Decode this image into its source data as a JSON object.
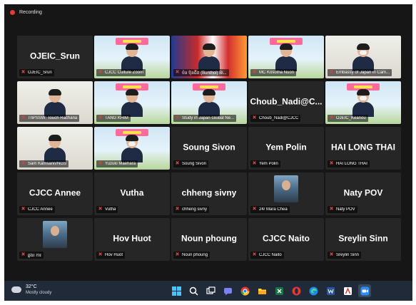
{
  "recording": {
    "label": "Recording"
  },
  "tiles": [
    {
      "name": "OJEIC_Srun",
      "label": "OJEIC_Srun"
    },
    {
      "label": "CJCC Culture Zoom"
    },
    {
      "label": "ប៉ន ប៊ុនធីត (Bunthol) Bl..."
    },
    {
      "label": "MC Kosotha Nuon"
    },
    {
      "label": "Embassy of Japan in Cam..."
    },
    {
      "label": "TriPSSW: Touch Rachana"
    },
    {
      "label": "TANG KHIM"
    },
    {
      "label": "Study in Japan Global Ne..."
    },
    {
      "name": "Choub_Nadi@C...",
      "label": "Choub_Nadi@CJCC"
    },
    {
      "label": "OJEIC_Keanou"
    },
    {
      "label": "Sam Kamsann/NGS"
    },
    {
      "label": "Yuzuki Maehara"
    },
    {
      "name": "Soung Sivon",
      "label": "Soung Sivon"
    },
    {
      "name": "Yem Polin",
      "label": "Yem Polin"
    },
    {
      "name": "HAI LONG THAI",
      "label": "HAI LONG THAI"
    },
    {
      "name": "CJCC Annee",
      "label": "CJCC Annee"
    },
    {
      "name": "Vutha",
      "label": "Vutha"
    },
    {
      "name": "chheng sivny",
      "label": "chheng sivny"
    },
    {
      "label": "24/ Mara Chea"
    },
    {
      "name": "Naty POV",
      "label": "Naty POV"
    },
    {
      "label": "ឆ្លងរ ការ"
    },
    {
      "name": "Hov Huot",
      "label": "Hov Huot"
    },
    {
      "name": "Noun phoung",
      "label": "Noun phoung"
    },
    {
      "name": "CJCC Naito",
      "label": "CJCC Naito"
    },
    {
      "name": "Sreylin Sinn",
      "label": "Sreylin Sinn"
    }
  ],
  "taskbar": {
    "weather": {
      "temperature": "32°C",
      "condition": "Mostly cloudy"
    },
    "icons": [
      "windows-start-icon",
      "search-icon",
      "task-view-icon",
      "teams-chat-icon",
      "chrome-icon",
      "file-explorer-icon",
      "excel-icon",
      "opera-icon",
      "edge-icon",
      "word-icon",
      "acrobat-icon",
      "zoom-icon"
    ]
  },
  "colors": {
    "screen": "#161616",
    "tile": "#262626",
    "muted": "#e53935",
    "active_speaker": "#f5d90a",
    "taskbar": "#202a38"
  }
}
